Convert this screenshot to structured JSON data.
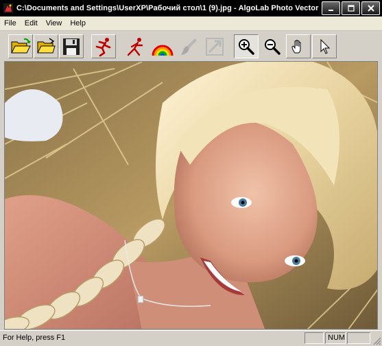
{
  "window": {
    "title": "C:\\Documents and Settings\\UserXP\\Рабочий стол\\1 (9).jpg - AlgoLab Photo Vector"
  },
  "menu": [
    {
      "label": "File"
    },
    {
      "label": "Edit"
    },
    {
      "label": "View"
    },
    {
      "label": "Help"
    }
  ],
  "toolbar": {
    "buttons": [
      {
        "icon": "open-folder-icon",
        "state": "raised"
      },
      {
        "icon": "open-folder-arrow-icon",
        "state": "raised"
      },
      {
        "icon": "floppy-disk-icon",
        "state": "raised"
      },
      {
        "icon": "running-man-icon",
        "state": "raised"
      },
      {
        "icon": "vectorize-figure-icon",
        "state": "flat"
      },
      {
        "icon": "rainbow-icon",
        "state": "flat"
      },
      {
        "icon": "brush-disabled-icon",
        "state": "disabled"
      },
      {
        "icon": "arrow-disabled-icon",
        "state": "disabled"
      },
      {
        "icon": "zoom-in-icon",
        "state": "pressed"
      },
      {
        "icon": "zoom-out-icon",
        "state": "flat"
      },
      {
        "icon": "hand-pan-icon",
        "state": "raised"
      },
      {
        "icon": "pointer-arrow-icon",
        "state": "raised"
      }
    ]
  },
  "status": {
    "text": "For Help, press F1",
    "num": "NUM"
  },
  "colors": {
    "titlebar": "#000000",
    "menubar": "#ece9d8",
    "face": "#d4d0c8"
  }
}
